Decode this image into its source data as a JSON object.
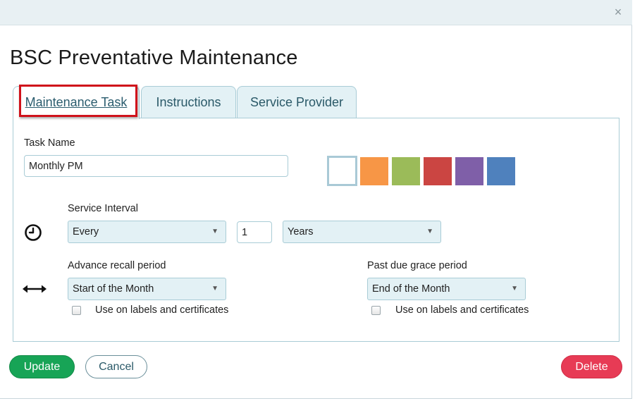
{
  "dialog": {
    "title": "BSC Preventative Maintenance",
    "close_icon": "×"
  },
  "tabs": [
    {
      "label": "Maintenance Task",
      "active": true
    },
    {
      "label": "Instructions",
      "active": false
    },
    {
      "label": "Service Provider",
      "active": false
    }
  ],
  "task": {
    "name_label": "Task Name",
    "name_value": "Monthly PM"
  },
  "colors": {
    "swatches": [
      "#ffffff",
      "#f79646",
      "#9bbb59",
      "#cb4542",
      "#7f5fa8",
      "#4f81bd"
    ],
    "selected": "#ffffff"
  },
  "service_interval": {
    "label": "Service Interval",
    "mode": "Every",
    "count": "1",
    "unit": "Years"
  },
  "advance_recall": {
    "label": "Advance recall period",
    "value": "Start of the Month",
    "checkbox_label": "Use on labels and certificates",
    "checked": false
  },
  "past_due": {
    "label": "Past due grace period",
    "value": "End of the Month",
    "checkbox_label": "Use on labels and certificates",
    "checked": false
  },
  "buttons": {
    "update": "Update",
    "cancel": "Cancel",
    "delete": "Delete"
  },
  "theme": {
    "update": "#17a456",
    "delete": "#e73b55",
    "highlight": "#d0121b"
  }
}
